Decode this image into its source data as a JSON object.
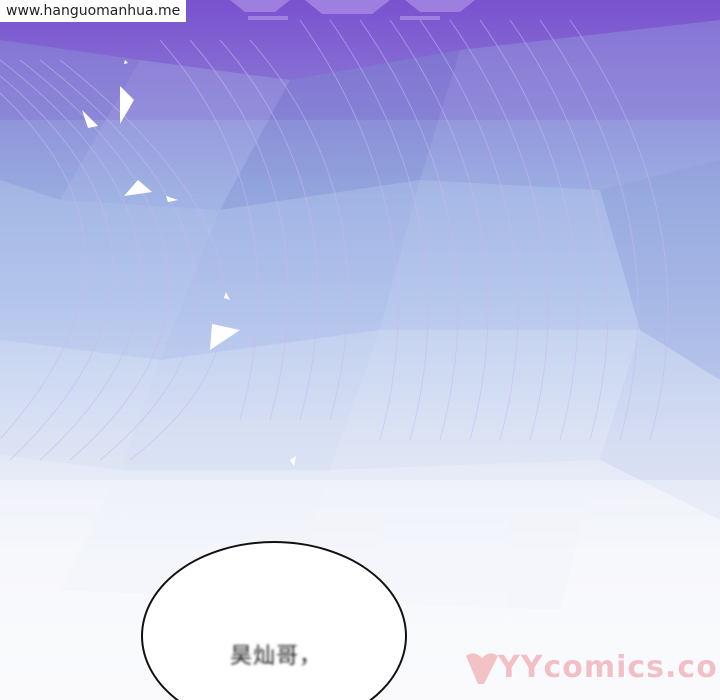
{
  "watermark": {
    "text": "www.hanguomanhua.me"
  },
  "bubble": {
    "text": "昊灿哥，"
  },
  "logo": {
    "text": "YYcomics.com"
  }
}
